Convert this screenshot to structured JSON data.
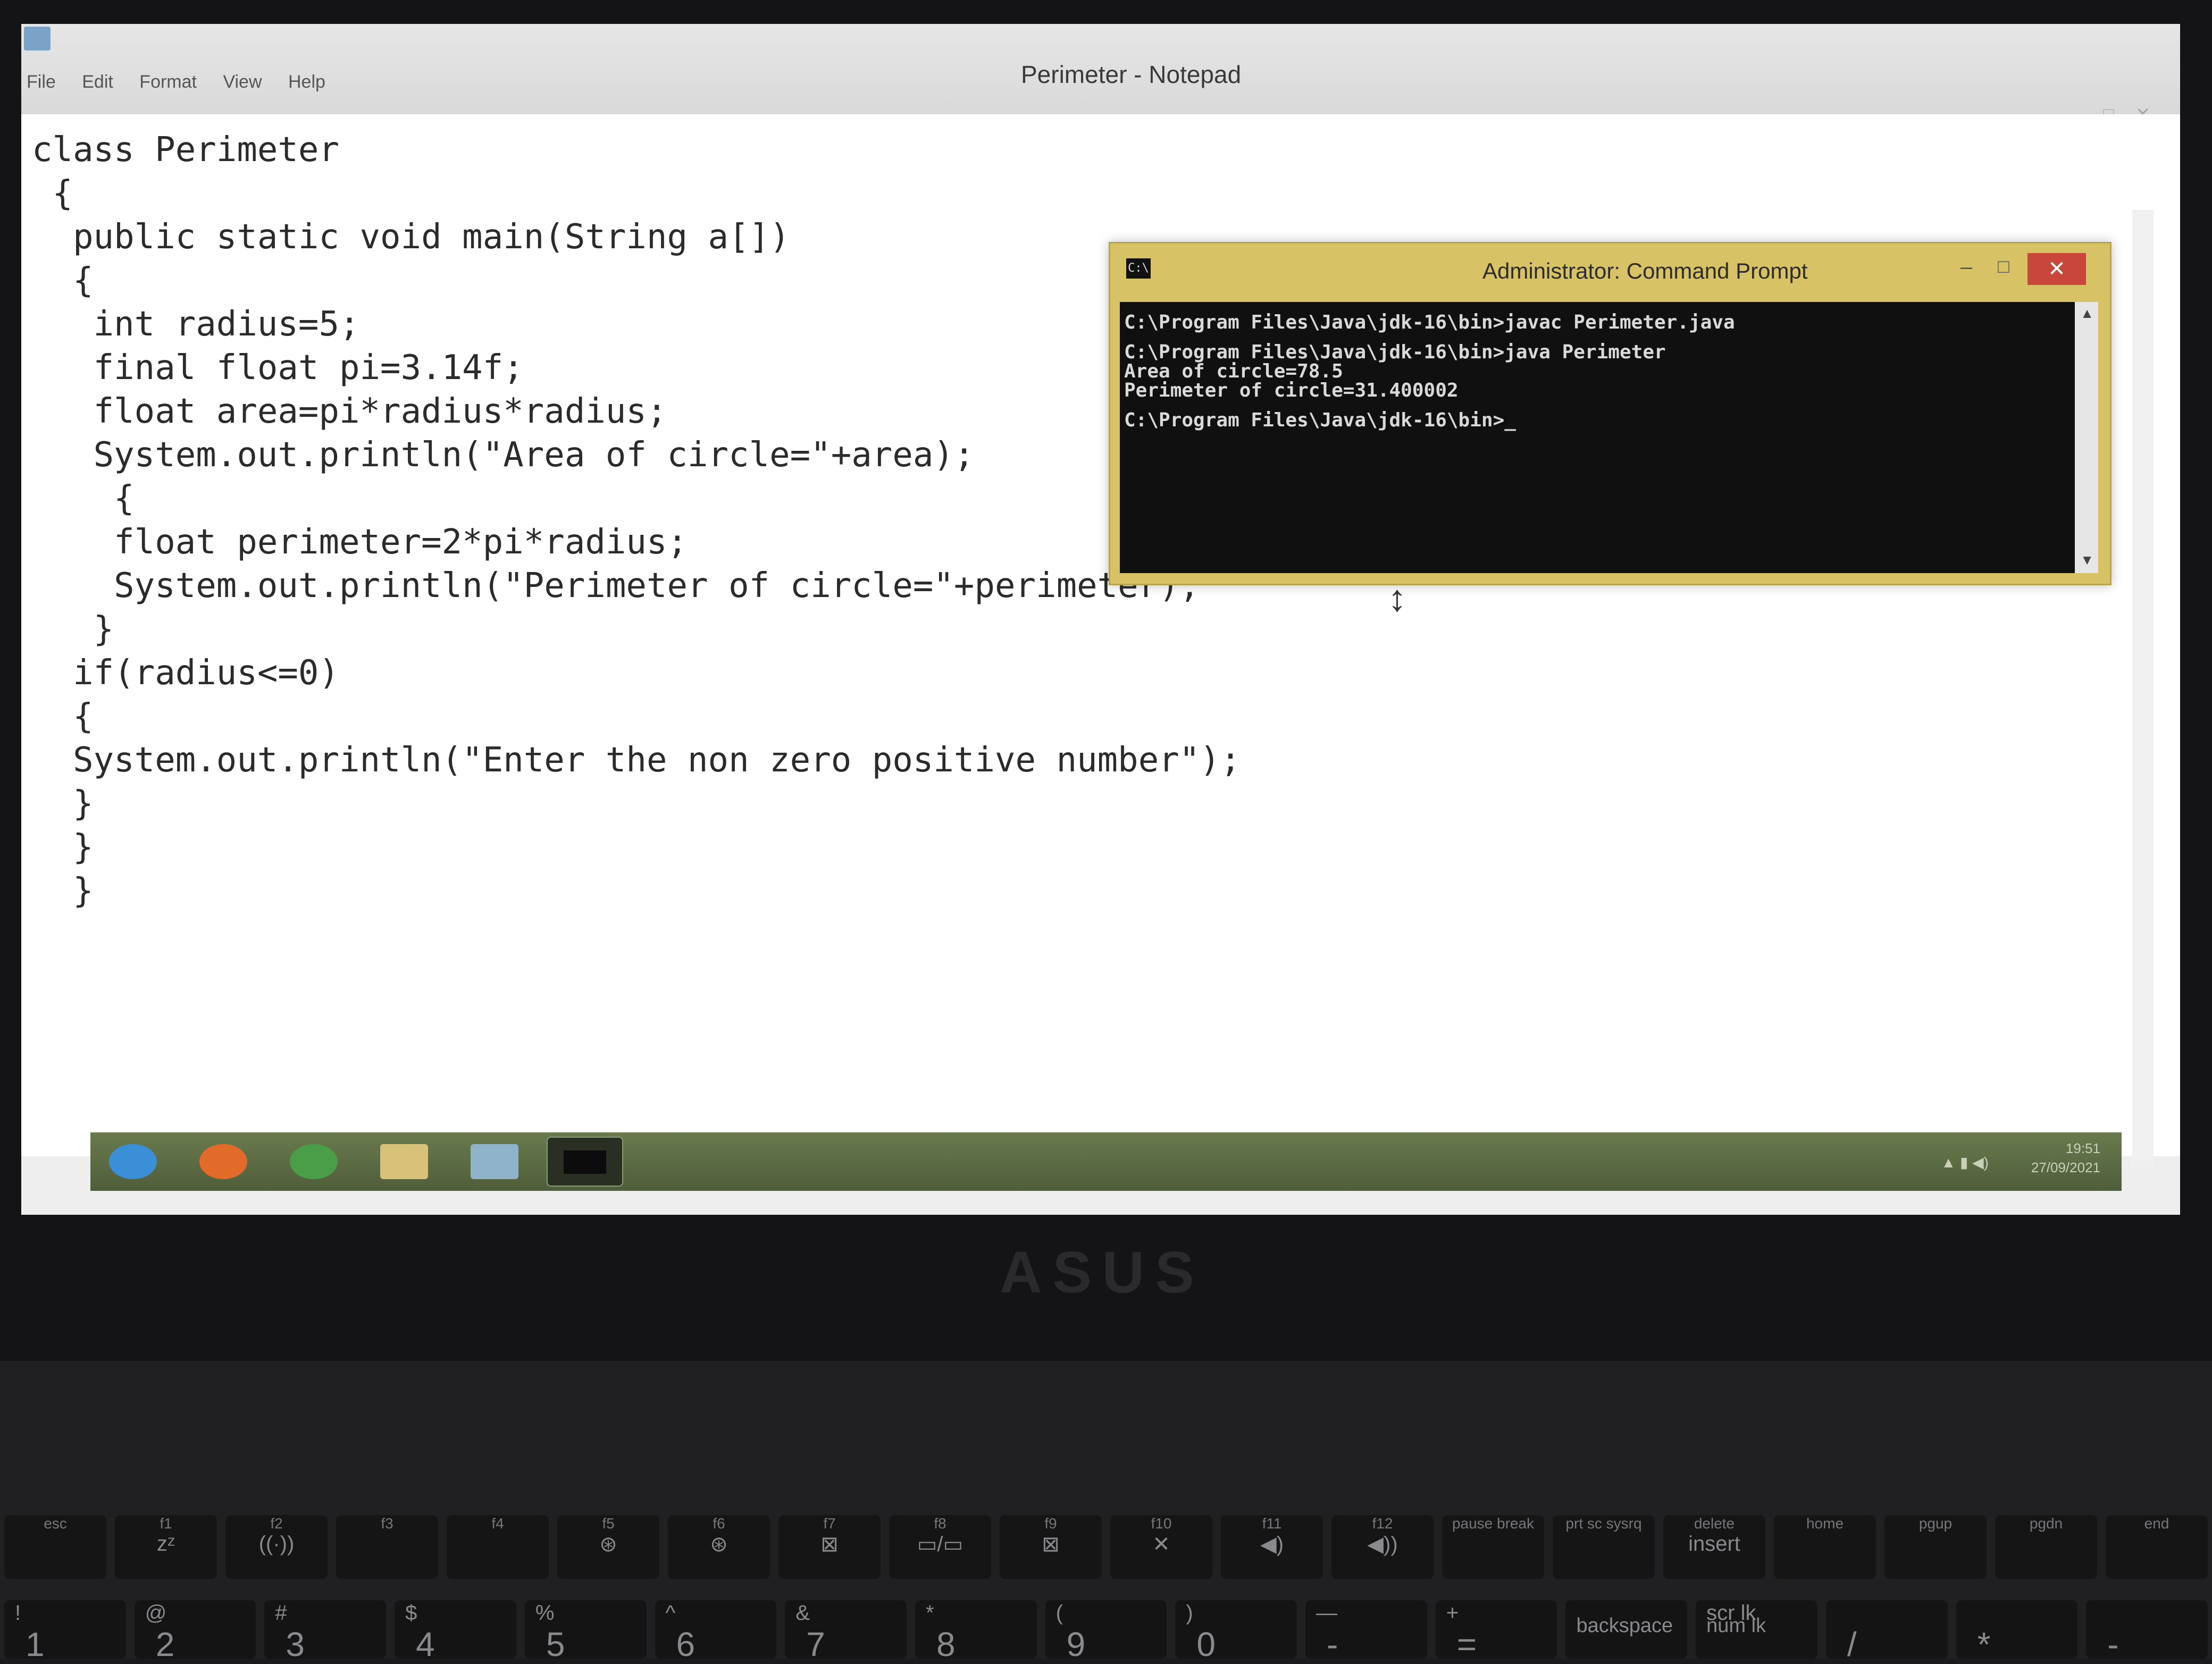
{
  "notepad": {
    "title": "Perimeter - Notepad",
    "menu": [
      "File",
      "Edit",
      "Format",
      "View",
      "Help"
    ],
    "controls": [
      "–",
      "□",
      "✕"
    ],
    "code_lines": [
      "class Perimeter",
      " {",
      "  public static void main(String a[])",
      "  {",
      "   int radius=5;",
      "   final float pi=3.14f;",
      "   float area=pi*radius*radius;",
      "   System.out.println(\"Area of circle=\"+area);",
      "    {",
      "    float perimeter=2*pi*radius;",
      "    System.out.println(\"Perimeter of circle=\"+perimeter);",
      "   }",
      "  if(radius<=0)",
      "  {",
      "  System.out.println(\"Enter the non zero positive number\");",
      "  }",
      "  }",
      "  }"
    ]
  },
  "cmd": {
    "title": "Administrator: Command Prompt",
    "icon_label": "C:\\",
    "minimize": "–",
    "maximize": "□",
    "close": "✕",
    "lines": [
      "C:\\Program Files\\Java\\jdk-16\\bin>javac Perimeter.java",
      "",
      "C:\\Program Files\\Java\\jdk-16\\bin>java Perimeter",
      "Area of circle=78.5",
      "Perimeter of circle=31.400002",
      "",
      "C:\\Program Files\\Java\\jdk-16\\bin>_"
    ]
  },
  "taskbar": {
    "apps": [
      {
        "name": "internet-explorer",
        "color": "#3a8fd6"
      },
      {
        "name": "firefox",
        "color": "#e26b2a"
      },
      {
        "name": "chrome",
        "color": "#4a9e47"
      },
      {
        "name": "file-explorer",
        "color": "#d8c27a"
      },
      {
        "name": "notepad",
        "color": "#8fb3c9"
      },
      {
        "name": "command-prompt",
        "color": "#0c0c0c"
      }
    ],
    "time": "19:51",
    "date": "27/09/2021"
  },
  "keyboard": {
    "brand": "ASUS",
    "fn_keys": [
      "esc",
      "f1",
      "f2",
      "f3",
      "f4",
      "f5",
      "f6",
      "f7",
      "f8",
      "f9",
      "f10",
      "f11",
      "f12",
      "pause break",
      "prt sc sysrq",
      "delete",
      "home",
      "pgup",
      "pgdn",
      "end"
    ],
    "fn_icons": [
      "",
      "zᶻ",
      "((·))",
      "",
      "",
      "⊛",
      "⊛",
      "⊠",
      "▭/▭",
      "⊠",
      "✕",
      "◀)",
      "◀))",
      "",
      "",
      "insert",
      "",
      "",
      "",
      ""
    ],
    "number_row": [
      {
        "main": "1",
        "shift": "!"
      },
      {
        "main": "2",
        "shift": "@"
      },
      {
        "main": "3",
        "shift": "#"
      },
      {
        "main": "4",
        "shift": "$"
      },
      {
        "main": "5",
        "shift": "%"
      },
      {
        "main": "6",
        "shift": "^"
      },
      {
        "main": "7",
        "shift": "&"
      },
      {
        "main": "8",
        "shift": "*"
      },
      {
        "main": "9",
        "shift": "("
      },
      {
        "main": "0",
        "shift": ")"
      },
      {
        "main": "-",
        "shift": "—"
      },
      {
        "main": "=",
        "shift": "+"
      },
      {
        "main": "backspace",
        "shift": ""
      },
      {
        "main": "num lk",
        "shift": "scr lk"
      },
      {
        "main": "/",
        "shift": ""
      },
      {
        "main": "*",
        "shift": ""
      },
      {
        "main": "-",
        "shift": ""
      }
    ]
  }
}
